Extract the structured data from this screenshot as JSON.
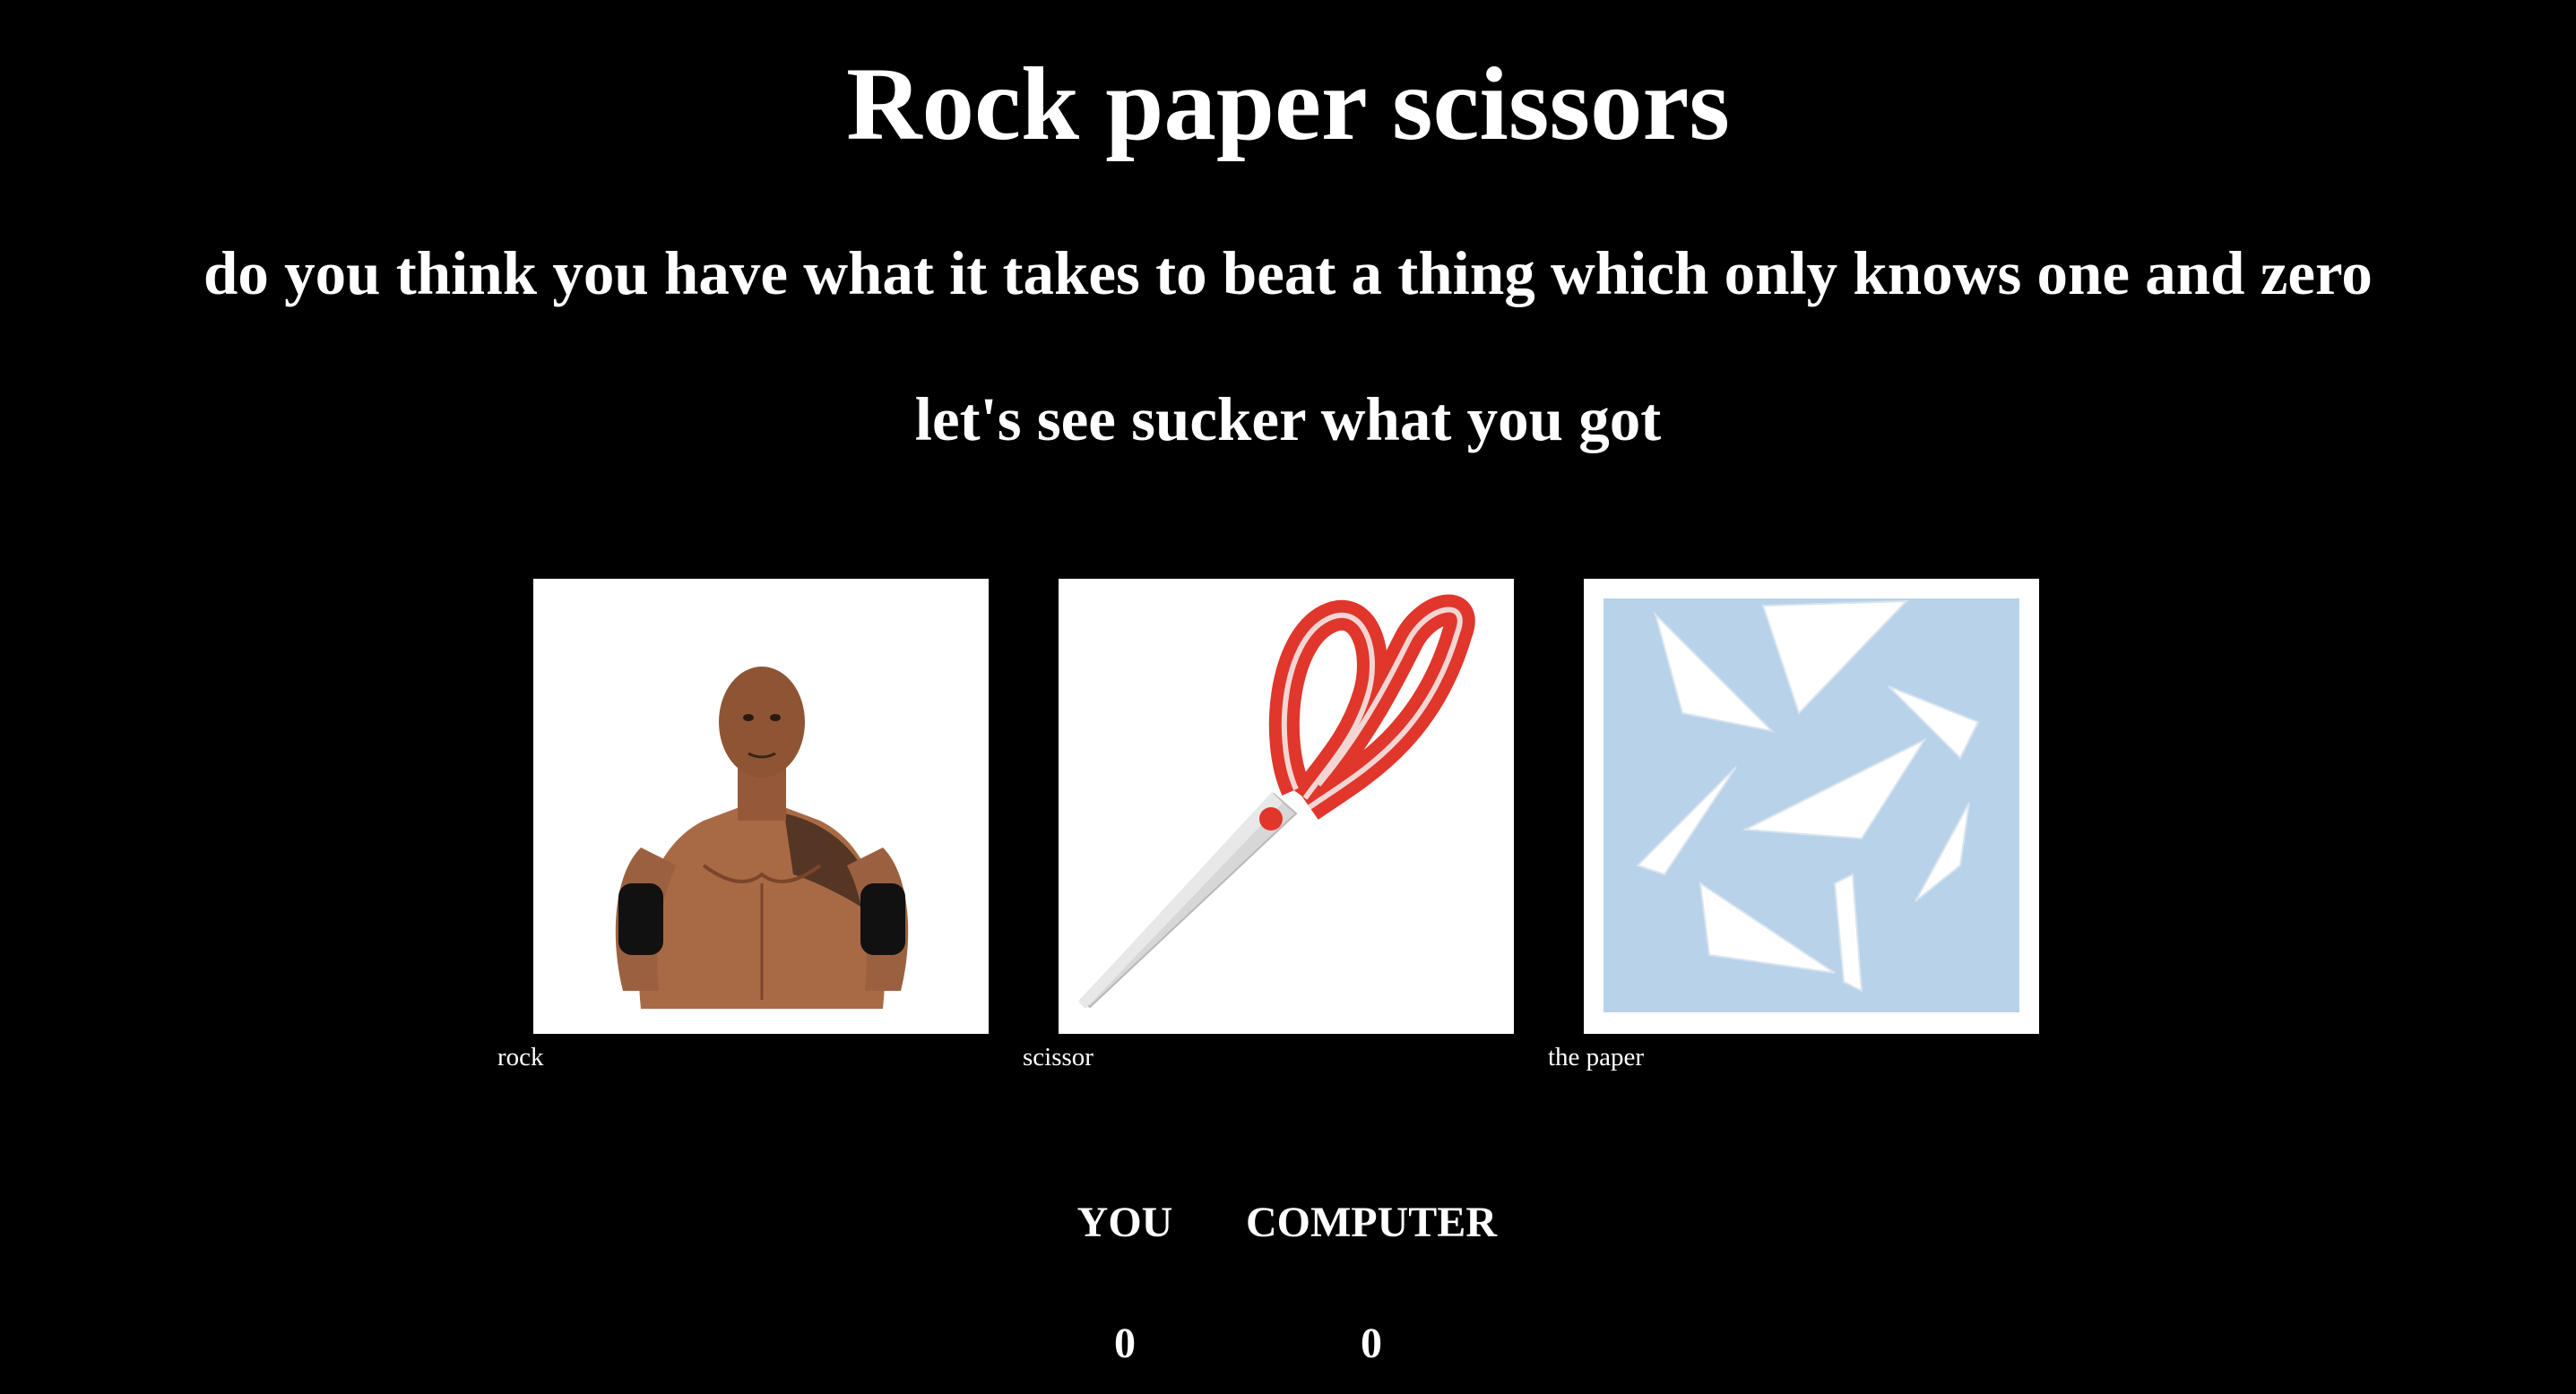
{
  "header": {
    "title": "Rock paper scissors",
    "subtitle": "do you think you have what it takes to beat a thing which only knows one and zero",
    "tagline": "let's see sucker what you got"
  },
  "choices": [
    {
      "label": "rock",
      "icon": "wrestler-photo-icon"
    },
    {
      "label": "scissor",
      "icon": "scissors-photo-icon"
    },
    {
      "label": "the paper",
      "icon": "paper-planes-photo-icon"
    }
  ],
  "scoreboard": {
    "you_label": "YOU",
    "computer_label": "COMPUTER",
    "you_score": "0",
    "computer_score": "0"
  },
  "colors": {
    "background": "#000000",
    "text": "#ffffff",
    "scissors_handle": "#e0362c",
    "paper_background": "#b8d2ea"
  }
}
